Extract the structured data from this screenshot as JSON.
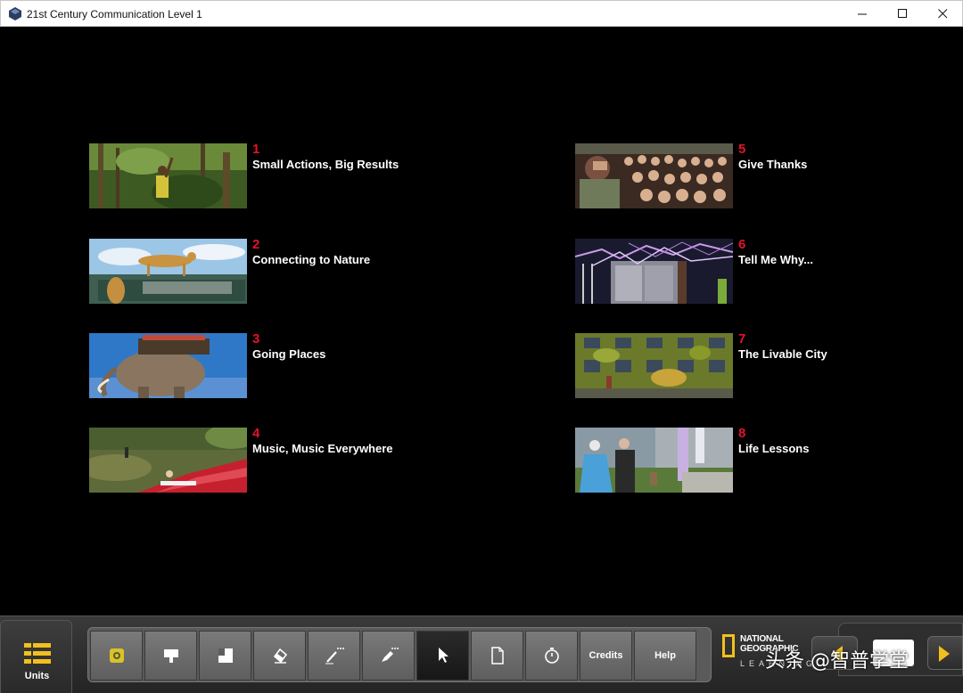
{
  "window": {
    "title": "21st Century Communication Level 1",
    "controls": [
      "minimize",
      "maximize",
      "close"
    ]
  },
  "units": [
    {
      "number": "1",
      "title": "Small Actions, Big Results",
      "image": "man-in-rainforest"
    },
    {
      "number": "2",
      "title": "Connecting to Nature",
      "image": "cheetahs-on-safari-jeep"
    },
    {
      "number": "3",
      "title": "Going Places",
      "image": "mechanical-elephant"
    },
    {
      "number": "4",
      "title": "Music, Music Everywhere",
      "image": "piano-in-field"
    },
    {
      "number": "5",
      "title": "Give Thanks",
      "image": "cheering-crowd"
    },
    {
      "number": "6",
      "title": "Tell Me Why...",
      "image": "tesla-coil-lightning"
    },
    {
      "number": "7",
      "title": "The Livable City",
      "image": "ivy-covered-building"
    },
    {
      "number": "8",
      "title": "Life Lessons",
      "image": "elderly-couple-dancing"
    }
  ],
  "toolbar": {
    "units_label": "Units",
    "tools": [
      {
        "name": "spotlight-icon",
        "label": ""
      },
      {
        "name": "screen-shade-icon",
        "label": ""
      },
      {
        "name": "reveal-icon",
        "label": ""
      },
      {
        "name": "eraser-icon",
        "label": ""
      },
      {
        "name": "pencil-icon",
        "label": ""
      },
      {
        "name": "highlighter-icon",
        "label": ""
      },
      {
        "name": "pointer-icon",
        "label": "",
        "active": true
      },
      {
        "name": "page-icon",
        "label": ""
      },
      {
        "name": "timer-icon",
        "label": ""
      },
      {
        "name": "credits",
        "label": "Credits"
      },
      {
        "name": "help",
        "label": "Help"
      }
    ],
    "brand": {
      "line1": "NATIONAL",
      "line2": "GEOGRAPHIC",
      "line3": "LEARNING"
    },
    "accent": "#f2c01c"
  },
  "watermark": "头条 @智普学堂",
  "colors": {
    "unit_number": "#e2122b",
    "background": "#000000"
  }
}
